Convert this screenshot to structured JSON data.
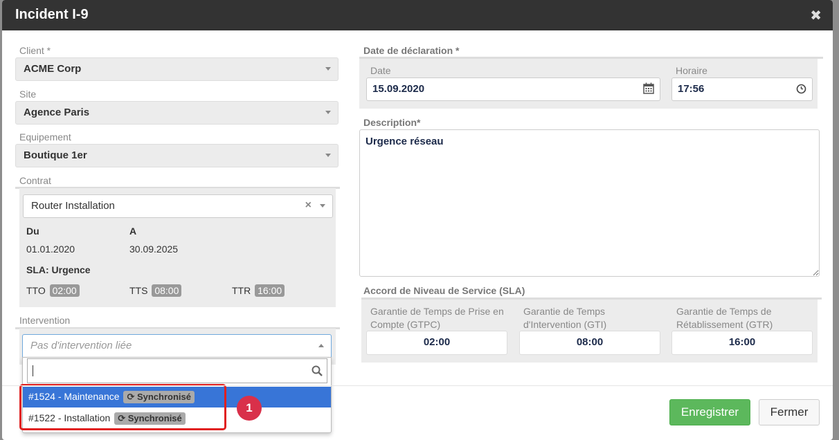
{
  "modal": {
    "title": "Incident I-9"
  },
  "left": {
    "client_label": "Client *",
    "client_value": "ACME Corp",
    "site_label": "Site",
    "site_value": "Agence Paris",
    "equipement_label": "Equipement",
    "equipement_value": "Boutique 1er",
    "contrat_label": "Contrat",
    "contrat_value": "Router Installation",
    "du_label": "Du",
    "du_value": "01.01.2020",
    "a_label": "A",
    "a_value": "30.09.2025",
    "sla_text": "SLA: Urgence",
    "tto_label": "TTO",
    "tto_value": "02:00",
    "tts_label": "TTS",
    "tts_value": "08:00",
    "ttr_label": "TTR",
    "ttr_value": "16:00",
    "intervention_label": "Intervention",
    "intervention_placeholder": "Pas d'intervention liée",
    "search_value": "",
    "options": [
      {
        "label": "#1524 - Maintenance",
        "badge": "Synchronisé",
        "selected": true
      },
      {
        "label": "#1522 - Installation",
        "badge": "Synchronisé",
        "selected": false
      }
    ]
  },
  "right": {
    "declaration_label": "Date de déclaration *",
    "date_label": "Date",
    "date_value": "15.09.2020",
    "time_label": "Horaire",
    "time_value": "17:56",
    "description_label": "Description*",
    "description_value": "Urgence réseau",
    "sla_label": "Accord de Niveau de Service (SLA)",
    "gtpc_label": "Garantie de Temps de Prise en Compte (GTPC)",
    "gtpc_value": "02:00",
    "gti_label": "Garantie de Temps d'Intervention (GTI)",
    "gti_value": "08:00",
    "gtr_label": "Garantie de Temps de Rétablissement (GTR)",
    "gtr_value": "16:00"
  },
  "annotation": {
    "number": "1"
  },
  "footer": {
    "save_label": "Enregistrer",
    "close_label": "Fermer"
  },
  "colors": {
    "header": "#333333",
    "accent": "#3875d7",
    "success": "#5cb85c",
    "annotation": "#e02020"
  },
  "icons": [
    "close-icon",
    "calendar-icon",
    "clock-icon",
    "search-icon",
    "sync-icon",
    "chevron-down-icon",
    "chevron-up-icon"
  ]
}
